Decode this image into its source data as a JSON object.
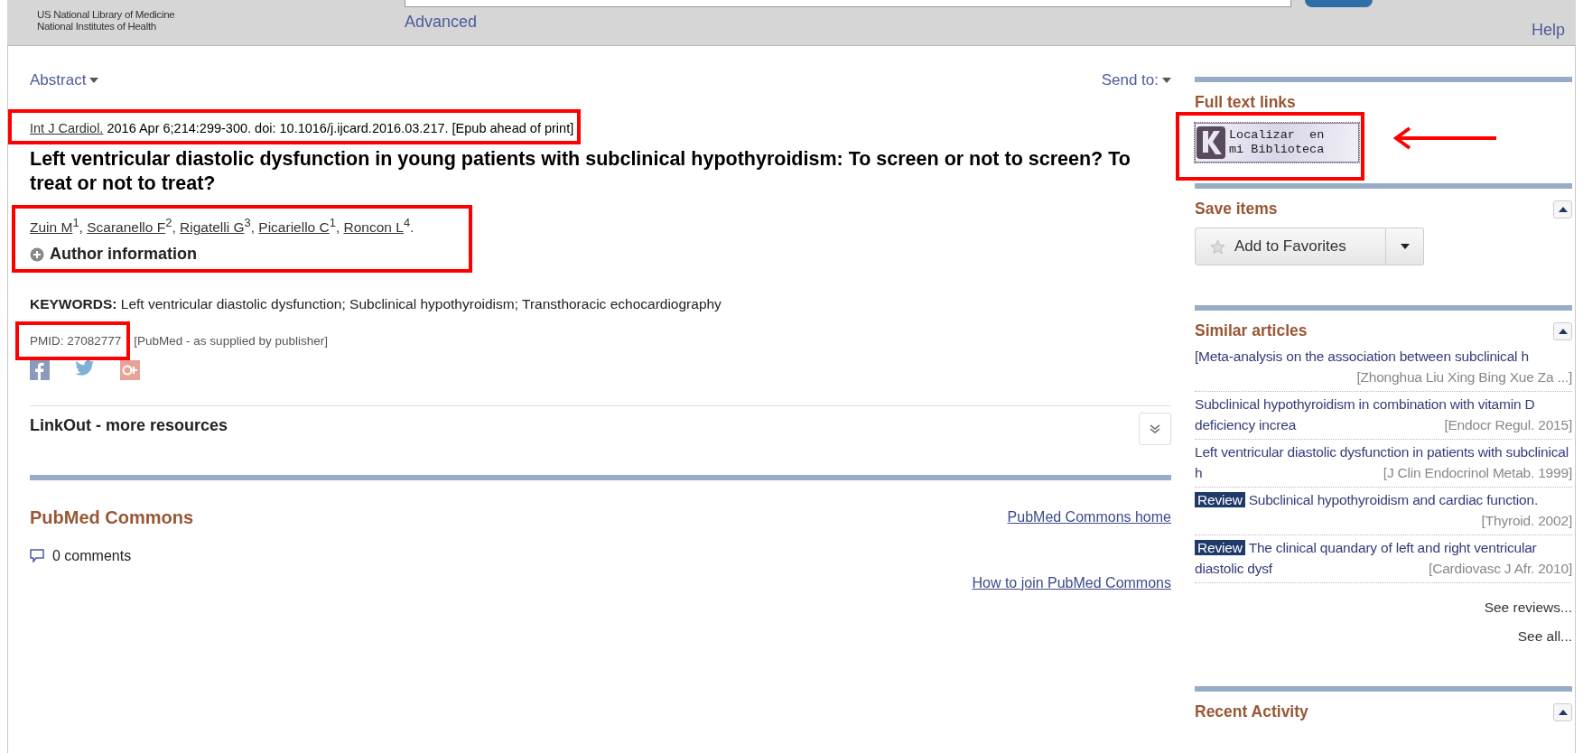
{
  "header": {
    "org_lines": [
      "US National Library of Medicine",
      "National Institutes of Health"
    ],
    "advanced_link": "Advanced",
    "help_link": "Help"
  },
  "article": {
    "format_menu": "Abstract",
    "send_to": "Send to:",
    "citation": {
      "journal": "Int J Cardiol.",
      "details": "2016 Apr 6;214:299-300. doi: 10.1016/j.ijcard.2016.03.217. [Epub ahead of print]"
    },
    "title": "Left ventricular diastolic dysfunction in young patients with subclinical hypothyroidism: To screen or not to screen? To treat or not to treat?",
    "authors": [
      {
        "name": "Zuin M",
        "sup": "1",
        "sep": ","
      },
      {
        "name": "Scaranello F",
        "sup": "2",
        "sep": ","
      },
      {
        "name": "Rigatelli G",
        "sup": "3",
        "sep": ","
      },
      {
        "name": "Picariello C",
        "sup": "1",
        "sep": ","
      },
      {
        "name": "Roncon L",
        "sup": "4",
        "sep": "."
      }
    ],
    "author_info": {
      "label": "Author information",
      "expanded": false
    },
    "keywords": {
      "label": "KEYWORDS:",
      "text": "Left ventricular diastolic dysfunction; Subclinical hypothyroidism; Transthoracic echocardiography"
    },
    "pmid": {
      "id": "PMID: 27082777",
      "status": "[PubMed - as supplied by publisher]"
    },
    "social": [
      {
        "kind": "facebook"
      },
      {
        "kind": "twitter"
      },
      {
        "kind": "googleplus"
      }
    ],
    "linkout": {
      "title": "LinkOut - more resources",
      "expanded": false
    },
    "commons": {
      "title": "PubMed Commons",
      "home_link": "PubMed Commons home",
      "comments": "0 comments",
      "join_link": "How to join PubMed Commons"
    }
  },
  "sidebar": {
    "full_text": {
      "title": "Full text links",
      "link_lines": [
        "Localizar  en",
        "mi Biblioteca"
      ]
    },
    "save": {
      "title": "Save items",
      "button": "Add to Favorites",
      "expanded": true
    },
    "similar": {
      "title": "Similar articles",
      "expanded": true,
      "items": [
        {
          "title": "[Meta-analysis on the association between subclinical h",
          "source": "[Zhonghua Liu Xing Bing Xue Za ...]"
        },
        {
          "title": "Subclinical hypothyroidism in combination with vitamin D deficiency increa",
          "source": "[Endocr Regul. 2015]"
        },
        {
          "title": "Left ventricular diastolic dysfunction in patients with subclinical h",
          "source": "[J Clin Endocrinol Metab. 1999]"
        },
        {
          "badge": "Review",
          "title": "Subclinical hypothyroidism and cardiac function.",
          "source": "[Thyroid. 2002]"
        },
        {
          "badge": "Review",
          "title": "The clinical quandary of left and right ventricular diastolic dysf",
          "source": "[Cardiovasc J Afr. 2010]"
        }
      ],
      "see_reviews": "See reviews...",
      "see_all": "See all..."
    },
    "recent": {
      "title": "Recent Activity",
      "expanded": true
    }
  }
}
